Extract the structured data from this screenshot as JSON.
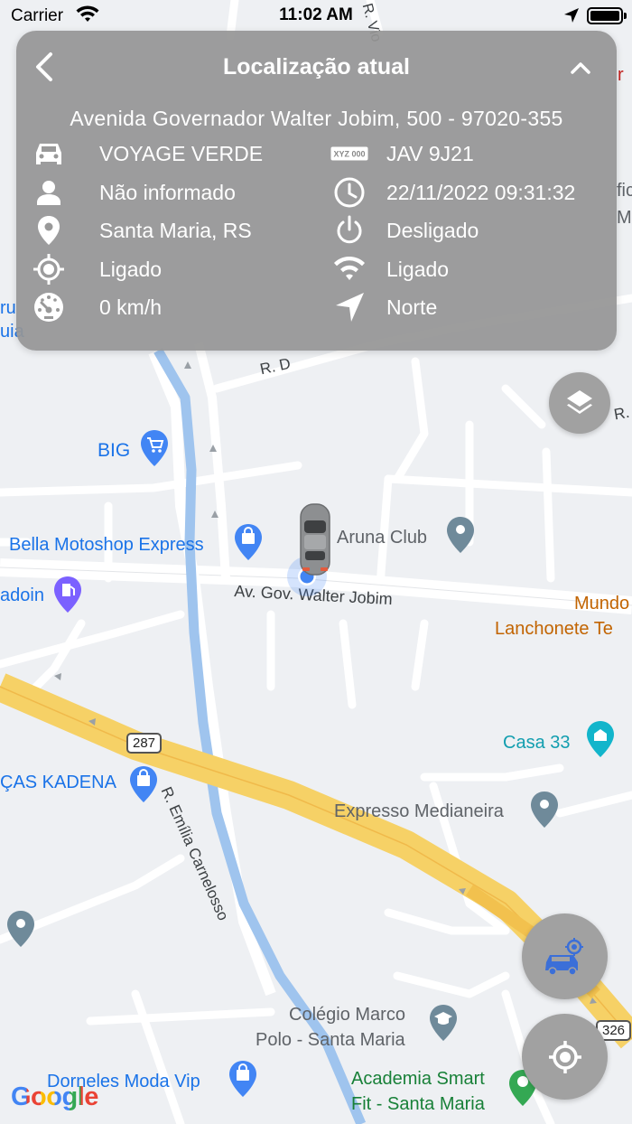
{
  "status_bar": {
    "carrier": "Carrier",
    "time": "11:02 AM"
  },
  "info_card": {
    "title": "Localização atual",
    "address": "Avenida Governador Walter Jobim, 500 - 97020-355",
    "left_rows": [
      {
        "icon": "car-icon",
        "value": "VOYAGE VERDE"
      },
      {
        "icon": "person-icon",
        "value": "Não informado"
      },
      {
        "icon": "location-pin-icon",
        "value": "Santa Maria, RS"
      },
      {
        "icon": "gps-target-icon",
        "value": "Ligado"
      },
      {
        "icon": "speedometer-icon",
        "value": "0 km/h"
      }
    ],
    "right_rows": [
      {
        "icon": "license-plate-icon",
        "value": "JAV 9J21",
        "plate_text": "XYZ 000"
      },
      {
        "icon": "clock-icon",
        "value": "22/11/2022 09:31:32"
      },
      {
        "icon": "power-icon",
        "value": "Desligado"
      },
      {
        "icon": "wifi-icon",
        "value": "Ligado"
      },
      {
        "icon": "navigation-arrow-icon",
        "value": "Norte"
      }
    ]
  },
  "map": {
    "labels": {
      "big": "BIG",
      "bella": "Bella Motoshop Express",
      "aruna": "Aruna Club",
      "avenue": "Av. Gov. Walter Jobim",
      "adoin": "adoin",
      "mundo": "Mundo",
      "lanchonete": "Lanchonete Te",
      "casa33": "Casa 33",
      "kadena": "ÇAS KADENA",
      "emilia": "R. Emília Carnelosso",
      "expresso": "Expresso Medianeira",
      "colegio1": "Colégio Marco",
      "colegio2": "Polo - Santa Maria",
      "academia1": "Academia Smart",
      "academia2": "Fit - Santa Maria",
      "dorneles": "Dorneles Moda Vip",
      "rd": "R. D",
      "r_da": "R. da",
      "r_vi": "R. Vio",
      "shield287": "287",
      "shield326": "326",
      "edge_ru": "ru",
      "edge_ui": "uia",
      "edge_fic": "fic",
      "edge_m": "M",
      "edge_r": "r"
    },
    "google": "Google"
  }
}
